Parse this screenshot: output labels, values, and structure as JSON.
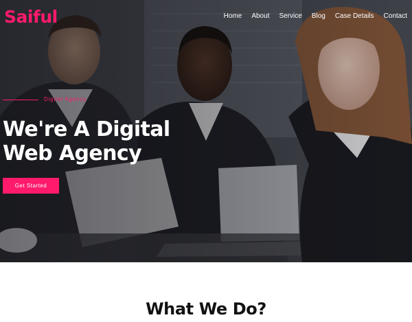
{
  "brand": {
    "logo_text": "Saiful",
    "accent_color": "#ff1a6c"
  },
  "nav": {
    "items": [
      {
        "label": "Home"
      },
      {
        "label": "About"
      },
      {
        "label": "Service"
      },
      {
        "label": "Blog"
      },
      {
        "label": "Case Details"
      },
      {
        "label": "Contact"
      }
    ]
  },
  "hero": {
    "tagline": "Digital Agency",
    "headline_line1": "We're A Digital",
    "headline_line2": "Web Agency",
    "cta_label": "Get Started",
    "background": "photo of three smiling business people at a table with a laptop"
  },
  "section": {
    "title": "What We Do?"
  }
}
